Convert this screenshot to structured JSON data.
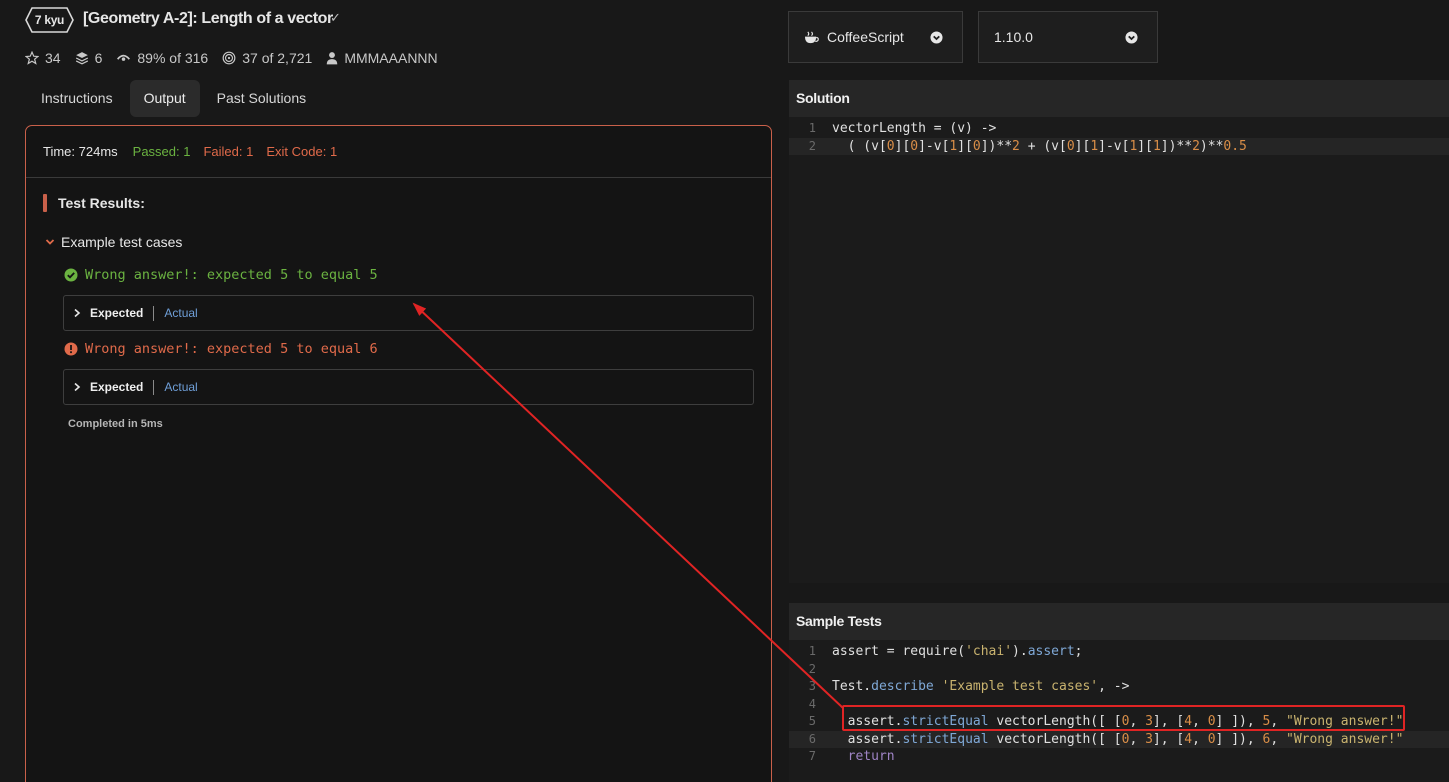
{
  "kata": {
    "rank": "7 kyu",
    "title": "[Geometry A-2]: Length of a vector",
    "check_mark": "✓"
  },
  "stats": {
    "stars": "34",
    "collections": "6",
    "satisfaction": "89%",
    "satisfaction_of": "of 316",
    "completed": "37",
    "completed_of": "of 2,721",
    "author": "MMMAAANNN"
  },
  "tabs": [
    {
      "label": "Instructions"
    },
    {
      "label": "Output"
    },
    {
      "label": "Past Solutions"
    }
  ],
  "active_tab": "Output",
  "output": {
    "time": "Time: 724ms",
    "passed": "Passed: 1",
    "failed": "Failed: 1",
    "exit_code": "Exit Code: 1",
    "results_title": "Test Results:",
    "group_title": "Example test cases",
    "tests": [
      {
        "status": "passed",
        "message": "Wrong answer!: expected 5 to equal 5",
        "expected_label": "Expected",
        "actual_label": "Actual"
      },
      {
        "status": "failed",
        "message": "Wrong answer!: expected 5 to equal 6",
        "expected_label": "Expected",
        "actual_label": "Actual"
      }
    ],
    "completed": "Completed in 5ms"
  },
  "language": {
    "name": "CoffeeScript",
    "version": "1.10.0"
  },
  "solution": {
    "title": "Solution",
    "lines": [
      {
        "n": "1"
      },
      {
        "n": "2"
      }
    ]
  },
  "sample_tests": {
    "title": "Sample Tests",
    "lines": [
      {
        "n": "1"
      },
      {
        "n": "2"
      },
      {
        "n": "3"
      },
      {
        "n": "4"
      },
      {
        "n": "5"
      },
      {
        "n": "6"
      },
      {
        "n": "7"
      }
    ]
  },
  "colors": {
    "accent": "#c9604a",
    "passed": "#6bb341",
    "failed": "#e06a4a",
    "annotation": "#e02424"
  }
}
